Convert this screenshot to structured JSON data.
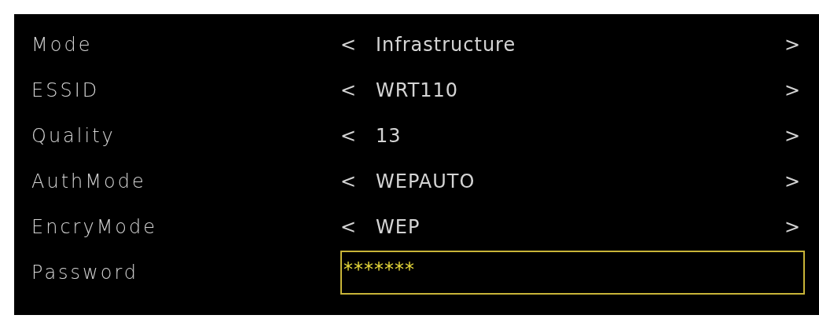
{
  "settings": [
    {
      "kind": "selector",
      "label": "Mode",
      "prev": "<",
      "value": "Infrastructure",
      "next": ">"
    },
    {
      "kind": "selector",
      "label": "ESSID",
      "prev": "<",
      "value": "WRT110",
      "next": ">"
    },
    {
      "kind": "selector",
      "label": "Quality",
      "prev": "<",
      "value": "13",
      "next": ">"
    },
    {
      "kind": "selector",
      "label": "AuthMode",
      "prev": "<",
      "value": "WEPAUTO",
      "next": ">"
    },
    {
      "kind": "selector",
      "label": "EncryMode",
      "prev": "<",
      "value": "WEP",
      "next": ">"
    },
    {
      "kind": "password",
      "label": "Password",
      "value": "*******"
    }
  ]
}
